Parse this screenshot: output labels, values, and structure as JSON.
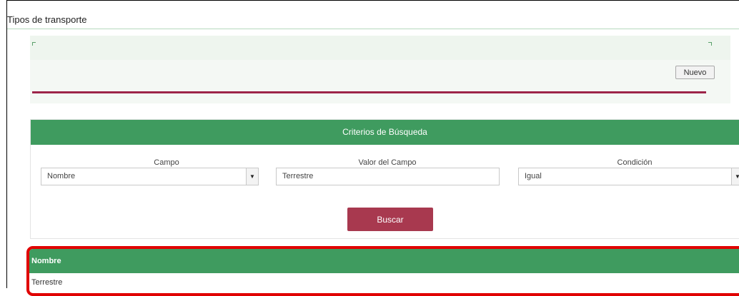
{
  "page": {
    "title": "Tipos de transporte"
  },
  "toolbar": {
    "new_label": "Nuevo"
  },
  "search": {
    "header": "Criterios de Búsqueda",
    "fields": [
      {
        "label": "Campo",
        "value": "Nombre"
      },
      {
        "label": "Valor del Campo",
        "value": "Terrestre"
      },
      {
        "label": "Condición",
        "value": "Igual"
      }
    ],
    "submit_label": "Buscar"
  },
  "results": {
    "columns": [
      "Nombre"
    ],
    "rows": [
      [
        "Terrestre"
      ]
    ]
  },
  "colors": {
    "header_green": "#3f9b5f",
    "accent_maroon": "#9d2449",
    "highlight_red": "#e00000"
  }
}
